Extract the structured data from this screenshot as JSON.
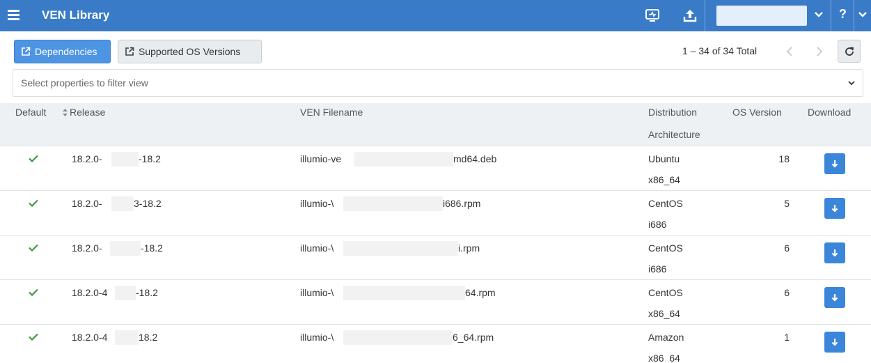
{
  "header": {
    "title": "VEN Library",
    "icons": [
      "menu-icon",
      "monitor-icon",
      "upload-icon",
      "chevron-down-icon",
      "help-icon"
    ],
    "help_label": "?",
    "accent_color": "#3a7bc8"
  },
  "toolbar": {
    "dependencies_label": "Dependencies",
    "supported_os_label": "Supported OS Versions",
    "count_text": "1 – 34 of 34 Total"
  },
  "filter": {
    "placeholder": "Select properties to filter view"
  },
  "table": {
    "headers": {
      "default": "Default",
      "release": "Release",
      "filename": "VEN Filename",
      "distribution": "Distribution",
      "architecture": "Architecture",
      "os_version": "OS Version",
      "download": "Download"
    },
    "rows": [
      {
        "release_a": "18.2.0-",
        "release_b": "-18.2",
        "file_a": "illumio-ve",
        "file_b": "md64.deb",
        "distribution": "Ubuntu",
        "architecture": "x86_64",
        "os_version": "18"
      },
      {
        "release_a": "18.2.0-",
        "release_b": "3-18.2",
        "file_a": "illumio-\\",
        "file_b": "i686.rpm",
        "distribution": "CentOS",
        "architecture": "i686",
        "os_version": "5"
      },
      {
        "release_a": "18.2.0-",
        "release_b": "-18.2",
        "file_a": "illumio-\\",
        "file_b": "i.rpm",
        "distribution": "CentOS",
        "architecture": "i686",
        "os_version": "6"
      },
      {
        "release_a": "18.2.0-4",
        "release_b": "-18.2",
        "file_a": "illumio-\\",
        "file_b": "64.rpm",
        "distribution": "CentOS",
        "architecture": "x86_64",
        "os_version": "6"
      },
      {
        "release_a": "18.2.0-4",
        "release_b": "18.2",
        "file_a": "illumio-\\",
        "file_b": "6_64.rpm",
        "distribution": "Amazon",
        "architecture": "x86_64",
        "os_version": "1"
      }
    ]
  }
}
